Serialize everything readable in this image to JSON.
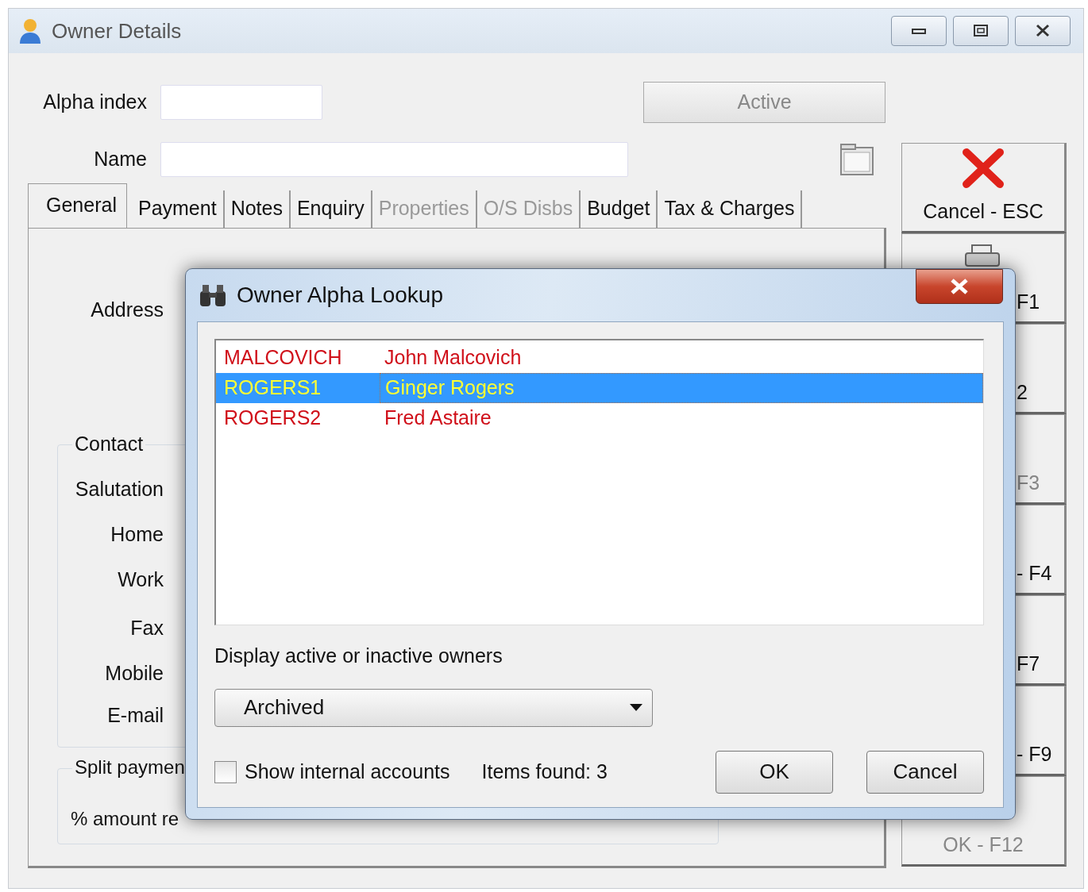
{
  "window": {
    "title": "Owner Details"
  },
  "fields": [
    {
      "label": "Alpha index"
    },
    {
      "label": "Name"
    }
  ],
  "active_button": {
    "label": "Active",
    "disabled": true
  },
  "tabs": [
    {
      "label": "General",
      "selected": true,
      "disabled": false
    },
    {
      "label": "Payment",
      "selected": false,
      "disabled": false
    },
    {
      "label": "Notes",
      "selected": false,
      "disabled": false
    },
    {
      "label": "Enquiry",
      "selected": false,
      "disabled": false
    },
    {
      "label": "Properties",
      "selected": false,
      "disabled": true
    },
    {
      "label": "O/S Disbs",
      "selected": false,
      "disabled": true
    },
    {
      "label": "Budget",
      "selected": false,
      "disabled": false
    },
    {
      "label": "Tax & Charges",
      "selected": false,
      "disabled": false
    }
  ],
  "address_label": "Address",
  "contact": {
    "title": "Contact",
    "labels": [
      "Salutation",
      "Home",
      "Work",
      "Fax",
      "Mobile",
      "E-mail"
    ]
  },
  "split": {
    "title": "Split paymen",
    "labels": [
      "% amount re"
    ]
  },
  "side_buttons": [
    {
      "label": "Cancel - ESC",
      "kind": "cancel",
      "disabled": false
    },
    {
      "label": "F1",
      "kind": "print",
      "disabled": false
    },
    {
      "label": "2",
      "kind": "partial",
      "disabled": false
    },
    {
      "label": "F3",
      "kind": "partial",
      "disabled": true
    },
    {
      "label": "- F4",
      "kind": "partial",
      "disabled": false
    },
    {
      "label": "F7",
      "kind": "partial",
      "disabled": false
    },
    {
      "label": "- F9",
      "kind": "partial",
      "disabled": false
    },
    {
      "label": "OK - F12",
      "kind": "ok",
      "disabled": true
    }
  ],
  "dialog": {
    "title": "Owner Alpha Lookup",
    "rows": [
      {
        "code": "MALCOVICH",
        "name": "John Malcovich",
        "selected": false
      },
      {
        "code": "ROGERS1",
        "name": "Ginger Rogers",
        "selected": true
      },
      {
        "code": "ROGERS2",
        "name": "Fred Astaire",
        "selected": false
      }
    ],
    "filter_label": "Display active or inactive owners",
    "filter": {
      "value": "Archived"
    },
    "show_internal": {
      "label": "Show internal accounts",
      "checked": false
    },
    "items_found": "Items found: 3",
    "buttons": [
      "OK",
      "Cancel"
    ]
  }
}
